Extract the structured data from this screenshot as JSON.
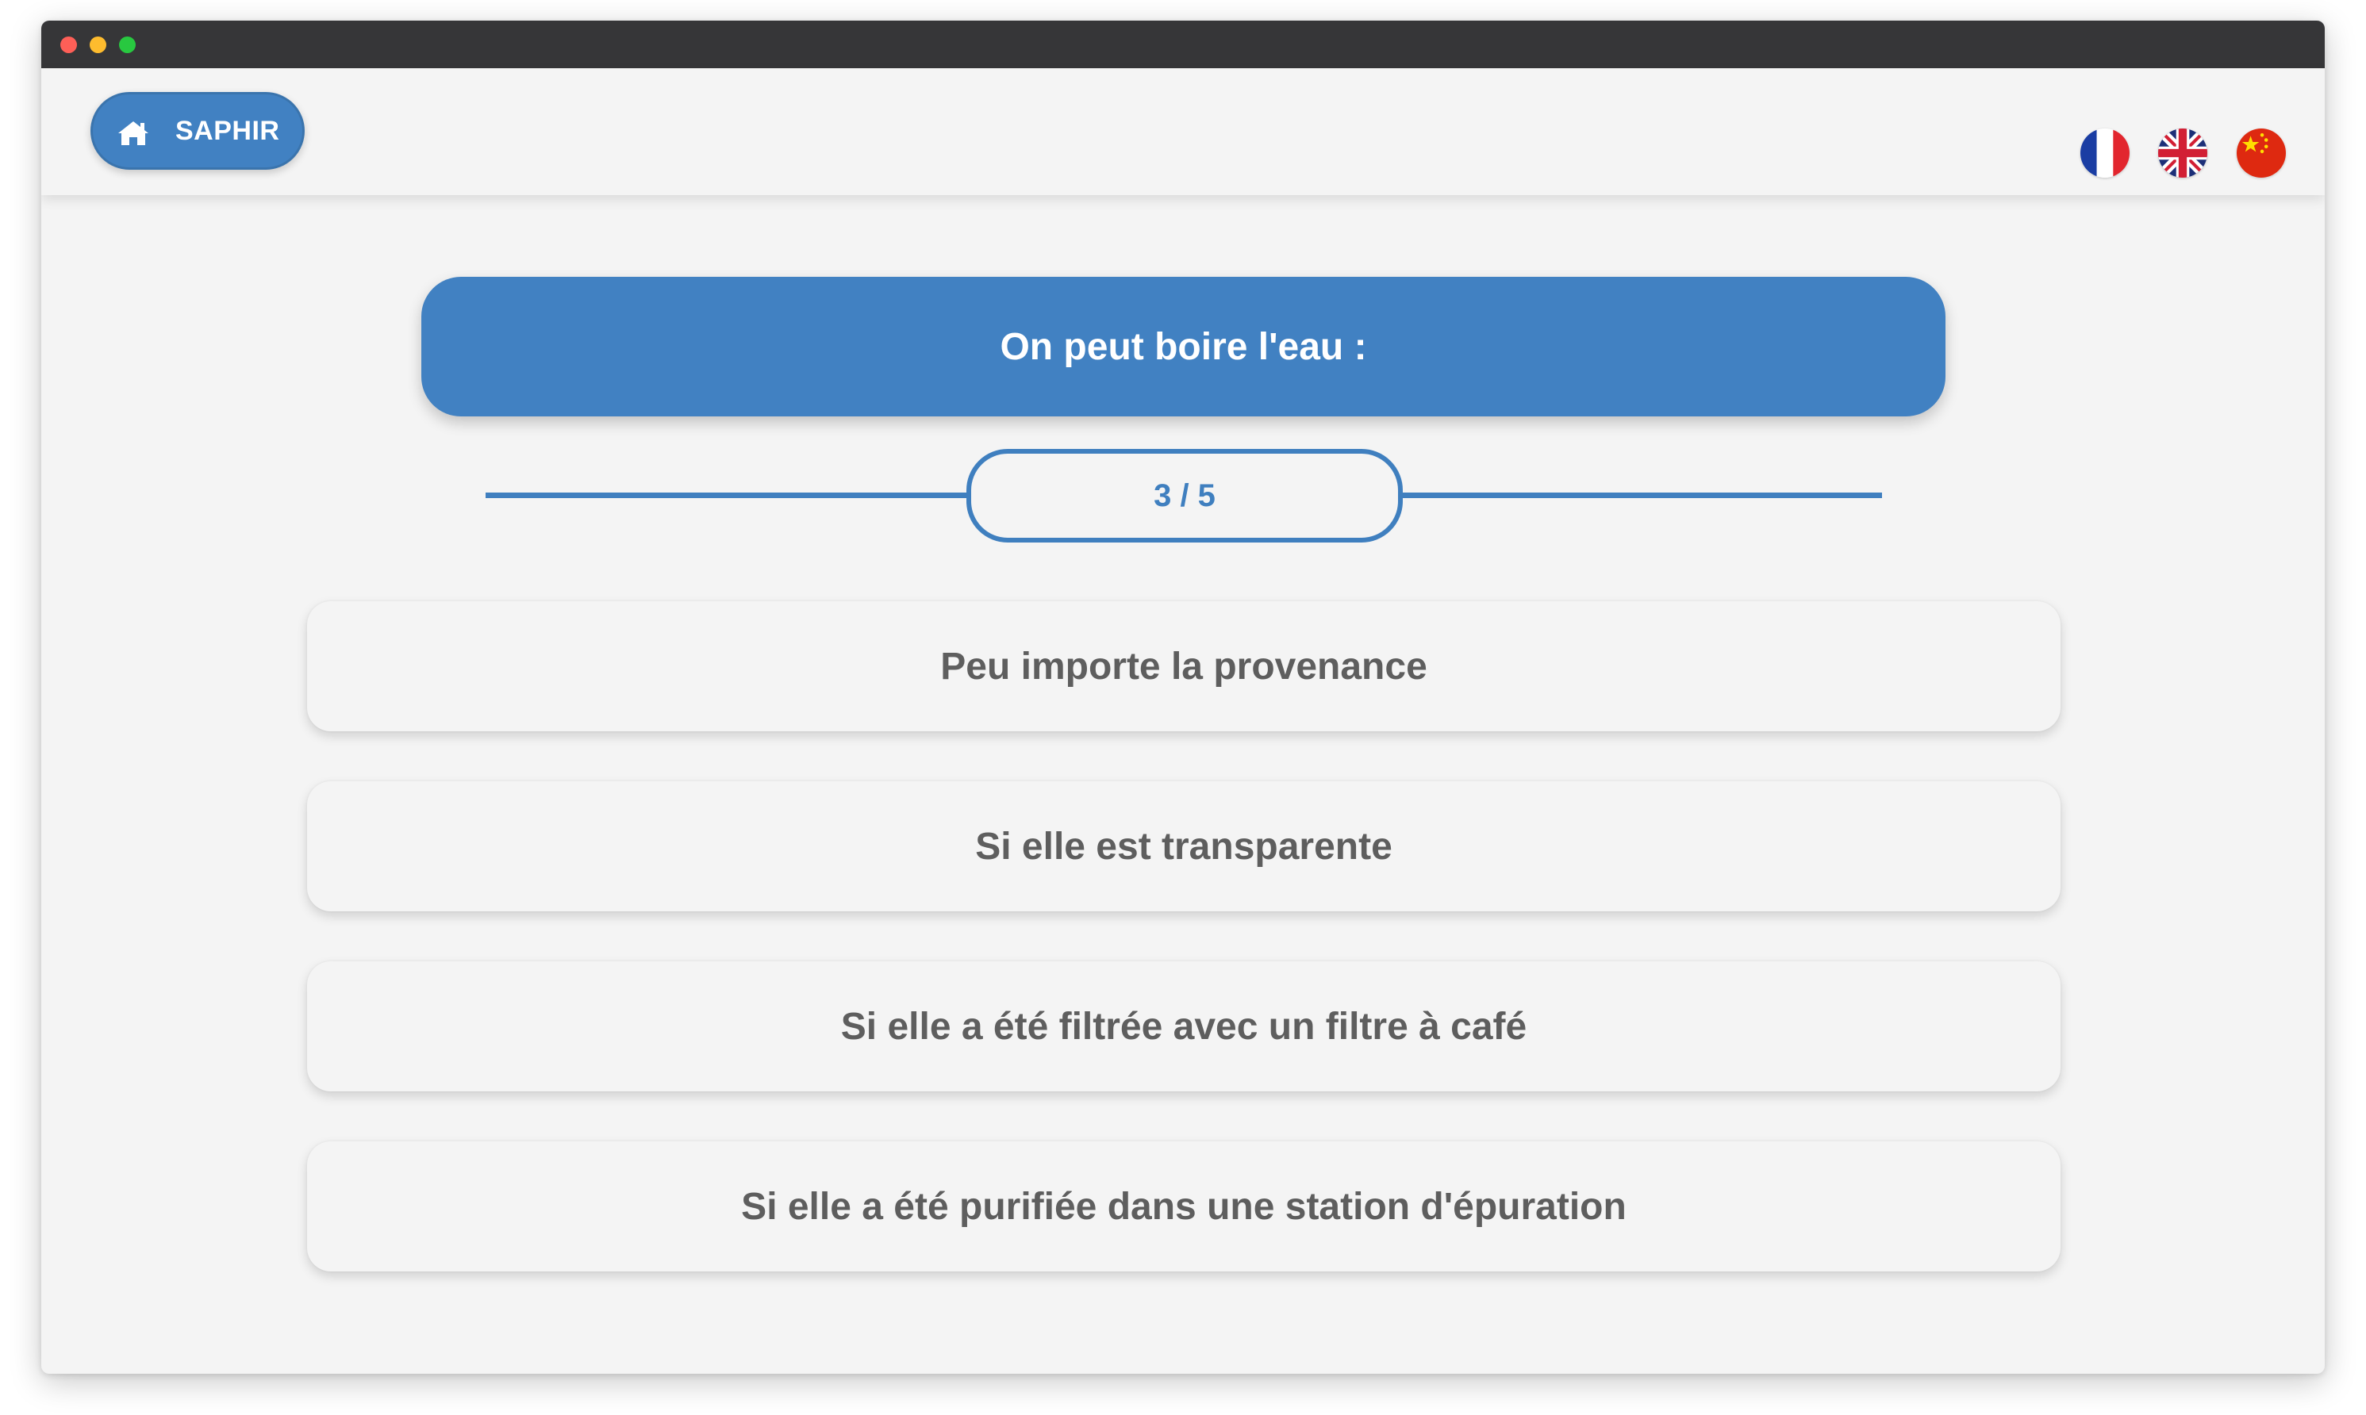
{
  "header": {
    "home_label": "SAPHIR",
    "home_icon": "home-icon",
    "languages": [
      {
        "code": "fr",
        "icon": "flag-france-icon"
      },
      {
        "code": "en",
        "icon": "flag-uk-icon"
      },
      {
        "code": "zh",
        "icon": "flag-china-icon"
      }
    ]
  },
  "quiz": {
    "question": "On peut boire l'eau :",
    "progress": "3 / 5",
    "progress_current": 3,
    "progress_total": 5,
    "answers": [
      {
        "label": "Peu importe la provenance"
      },
      {
        "label": "Si elle est transparente"
      },
      {
        "label": "Si elle a été filtrée avec un filtre à café"
      },
      {
        "label": "Si elle a été purifiée dans une station d'épuration"
      }
    ]
  },
  "colors": {
    "accent": "#4181c2",
    "background": "#f4f4f4",
    "answer_text": "#5e5e5e"
  }
}
